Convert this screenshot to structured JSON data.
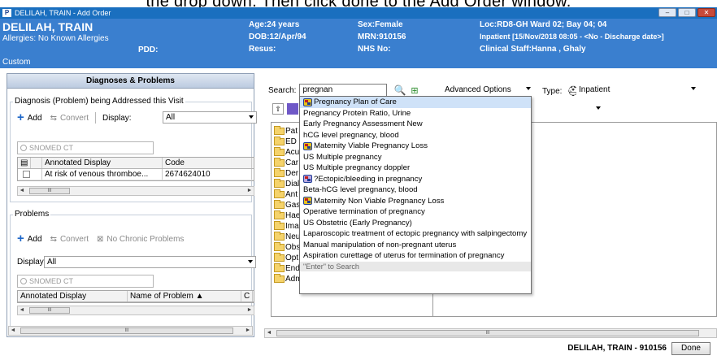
{
  "caption": "the drop down. Then click done to the Add Order window.",
  "window": {
    "app_icon": "P",
    "title": "DELILAH, TRAIN - Add Order",
    "buttons": [
      "minimize",
      "restore",
      "close"
    ]
  },
  "banner": {
    "patient_name": "DELILAH, TRAIN",
    "allergies": "Allergies: No Known Allergies",
    "pdd": "PDD:",
    "custom": "Custom",
    "age": "Age:24 years",
    "dob": "DOB:12/Apr/94",
    "resus": "Resus:",
    "sex": "Sex:Female",
    "mrn": "MRN:910156",
    "nhs": "NHS No:",
    "loc": "Loc:RD8-GH Ward 02; Bay 04; 04",
    "encounter": "Inpatient [15/Nov/2018 08:05 - <No - Discharge date>]",
    "clinical_staff": "Clinical Staff:Hanna , Ghaly"
  },
  "left": {
    "header": "Diagnoses & Problems",
    "diagnosis_group": "Diagnosis (Problem) being Addressed this Visit",
    "add": "Add",
    "convert": "Convert",
    "display_label": "Display:",
    "display_value": "All",
    "snomed_placeholder": "SNOMED CT",
    "diag_cols": [
      "Annotated Display",
      "Code"
    ],
    "diag_rows": [
      {
        "display": "At risk of venous thromboe...",
        "code": "2674624010"
      }
    ],
    "problems_group": "Problems",
    "no_chronic": "No Chronic Problems",
    "prob_display_label": "Display:",
    "prob_display_value": "All",
    "prob_cols": [
      "Annotated Display",
      "Name of Problem ▲",
      "C"
    ],
    "scroll_mark": "III"
  },
  "right": {
    "search_label": "Search:",
    "search_value": "pregnan",
    "advanced": "Advanced Options",
    "type_label": "Type:",
    "type_value": "Inpatient",
    "tree": [
      "Pat",
      "ED",
      "Acu",
      "Car",
      "Der",
      "Dial",
      "Ant",
      "Gas",
      "Hae",
      "Ima",
      "Neu",
      "Obs",
      "Opt",
      "Endoscopy (EN)",
      "Admissions"
    ],
    "scroll_mark": "III"
  },
  "dropdown": {
    "items": [
      {
        "label": "Pregnancy Plan of Care",
        "icon": "order-icon",
        "highlight": true
      },
      {
        "label": "Pregnancy Protein Ratio, Urine",
        "icon": ""
      },
      {
        "label": "Early Pregnancy Assessment New",
        "icon": ""
      },
      {
        "label": "hCG level pregnancy, blood",
        "icon": ""
      },
      {
        "label": "Maternity Viable Pregnancy Loss",
        "icon": "order-icon"
      },
      {
        "label": "US Multiple pregnancy",
        "icon": ""
      },
      {
        "label": "US Multiple pregnancy doppler",
        "icon": ""
      },
      {
        "label": "?Ectopic/bleeding in pregnancy",
        "icon": "order-icon-purple"
      },
      {
        "label": "Beta-hCG level pregnancy, blood",
        "icon": ""
      },
      {
        "label": "Maternity Non Viable Pregnancy Loss",
        "icon": "order-icon"
      },
      {
        "label": "Operative termination of pregnancy",
        "icon": ""
      },
      {
        "label": "US Obstetric (Early Pregnancy)",
        "icon": ""
      },
      {
        "label": "Laparoscopic treatment of ectopic pregnancy with salpingectomy",
        "icon": ""
      },
      {
        "label": "Manual manipulation of non-pregnant uterus",
        "icon": ""
      },
      {
        "label": "Aspiration curettage of uterus for termination of pregnancy",
        "icon": ""
      }
    ],
    "footer": "\"Enter\" to Search"
  },
  "status": {
    "patient": "DELILAH, TRAIN - 910156",
    "done": "Done"
  }
}
